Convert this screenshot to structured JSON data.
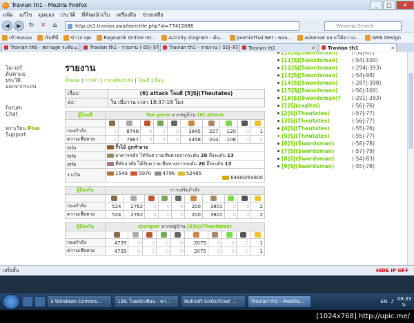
{
  "window": {
    "title": "Travian th1 - Mozilla Firefox"
  },
  "menu": [
    "แฟ้ม",
    "แก้ไข",
    "มุมมอง",
    "ประวัติ",
    "ที่คั่นหน้าเว็บ",
    "เครื่องมือ",
    "ช่วยเหลือ"
  ],
  "nav": {
    "url": "http://s1.travian.asia/berichte.php?id=77412086",
    "search_placeholder": "Winamp Search"
  },
  "bookmarks": [
    "เข้าชมบ่อย",
    "เริ่มที่นี่",
    "ข่าวล่าสุด",
    "Ragnarok Online Int...",
    "Activity diagram - ค้น...",
    "JoomlaThai.Net : ขอน...",
    "Adsense อยากได้ความ...",
    "Web Design"
  ],
  "tabs": [
    "Travian th6 - สถานทูต ระดับ ...",
    "Travian th1 - รายงาน (-55|-77)",
    "Travian th1 - รายงาน (-55|-77)",
    "Travian th1",
    "Travian th1"
  ],
  "sidebar": {
    "items": [
      "โอเวอร์",
      "ค้นหาแม่",
      "ประวัติ",
      "ออกจากระบบ"
    ],
    "forum": "Forum",
    "chat": "Chat",
    "plus_prefix": "ทราเวียน",
    "plus": "Plus",
    "support": "Support"
  },
  "page": {
    "title": "รายงาน",
    "subnav": [
      "ทั้งหมด",
      "การค้า",
      "การเสริมกำลัง",
      "โจมตี",
      "อื่นๆ"
    ]
  },
  "header": {
    "subject_label": "เรื่อง:",
    "subject": "(6) attack โจมตี [5]SJ(Theutates)",
    "sent_label": "ส่ง:",
    "sent": "ใน เมื่อวาน เวลา 18:37:18 โมง"
  },
  "attacker": {
    "role": "ผู้โจมตี",
    "name": "Tae.yeon",
    "from": "จากหมู่บ้าน",
    "village": "(6) attack",
    "troops_label": "กองกำลัง",
    "troops": [
      "0",
      "8748",
      "0",
      "0",
      "0",
      "3845",
      "227",
      "120",
      "0",
      "1"
    ],
    "casualties_label": "ความเสียหาย",
    "casualties": [
      "0",
      "7867",
      "0",
      "0",
      "0",
      "3458",
      "204",
      "108",
      "0",
      "0"
    ],
    "info_label": "Info",
    "info1": "รั้วไม้ ถูกทำลาย",
    "info2": "อาคารหลัก ได้รับความเสียหายจากระดับ",
    "info2_level": "20",
    "info2_to": "ถึงระดับ",
    "info2_new": "13",
    "info3": "ที่พักอาศัย ได้รับความเสียหายจากระดับ",
    "info3_level": "20",
    "info3_to": "ถึงระดับ",
    "info3_new": "13",
    "bounty_label": "รางวัล",
    "bounty": [
      "1549",
      "5970",
      "4796",
      "52485"
    ],
    "capacity": "64800/64800"
  },
  "defender1": {
    "role": "ผู้ป้องกัน",
    "title": "การเสริมกำลัง",
    "troops_label": "กองกำลัง",
    "troops": [
      "524",
      "2782",
      "0",
      "0",
      "0",
      "200",
      "3801",
      "0",
      "0",
      "2"
    ],
    "casualties_label": "ความเสียหาย",
    "casualties": [
      "524",
      "2782",
      "0",
      "0",
      "0",
      "200",
      "3801",
      "0",
      "0",
      "2"
    ]
  },
  "defender2": {
    "role": "ผู้ป้องกัน",
    "name": "sjsniper",
    "from": "จากหมู่บ้าน",
    "village": "[5]SJ(Theutates)",
    "troops_label": "กองกำลัง",
    "troops": [
      "4739",
      "0",
      "0",
      "0",
      "0",
      "2075",
      "0",
      "0",
      "0",
      "1"
    ],
    "casualties_label": "ความเสียหาย",
    "casualties": [
      "4739",
      "0",
      "0",
      "0",
      "0",
      "2075",
      "0",
      "0",
      "0",
      "1"
    ]
  },
  "villages": [
    {
      "name": "[10]SJ(Swordsman)",
      "coords": "(-54|-81)"
    },
    {
      "name": "[11]SJ(Swordsman)",
      "coords": "(-54|-100)"
    },
    {
      "name": "[12]SJ(Swordsman)",
      "coords": "(-294|-393)"
    },
    {
      "name": "[13]SJ(Swordsman)",
      "coords": "(-54|-98)"
    },
    {
      "name": "[14]SJ(Swordsman)",
      "coords": "(-287|-398)"
    },
    {
      "name": "[15]SJ(Swordsman)",
      "coords": "(-56|-100)"
    },
    {
      "name": "[16]SJ(Swordsman)?",
      "coords": "(-291|-393)"
    },
    {
      "name": "[1]SJ(capital)",
      "coords": "(-56|-76)"
    },
    {
      "name": "[2]SJ(Theutates)",
      "coords": "(-57|-77)"
    },
    {
      "name": "[3]SJ(Theutates)",
      "coords": "(-56|-77)"
    },
    {
      "name": "[4]SJ(Theutates)",
      "coords": "(-55|-76)"
    },
    {
      "name": "[5]SJ(Theutates)",
      "coords": "(-55|-77)"
    },
    {
      "name": "[6]SJ(Swordsman)",
      "coords": "(-58|-78)"
    },
    {
      "name": "[7]SJ(Swordsman)",
      "coords": "(-57|-79)"
    },
    {
      "name": "[8]SJ(Swordsman)",
      "coords": "(-54|-83)"
    },
    {
      "name": "[9]SJ(Swordsman)",
      "coords": "(-55|-78)"
    }
  ],
  "status": {
    "left": "เสร็จสิ้น",
    "right": "HIDE IP OFF"
  },
  "taskbar": {
    "tasks": [
      "3 Windows Comma...",
      "139. ไอพนักเขียน - ซา...",
      "Nullsoft SHOUTcast ...",
      "Travian th1 - Mozilla..."
    ],
    "lang": "EN",
    "time": "08:33",
    "ampm": "น."
  },
  "watermark": "[1024x768] http://upic.me/",
  "colors": {
    "green": "#71d000",
    "firefox_frame": "#dfe9f5",
    "taskbar": "#284a70"
  }
}
